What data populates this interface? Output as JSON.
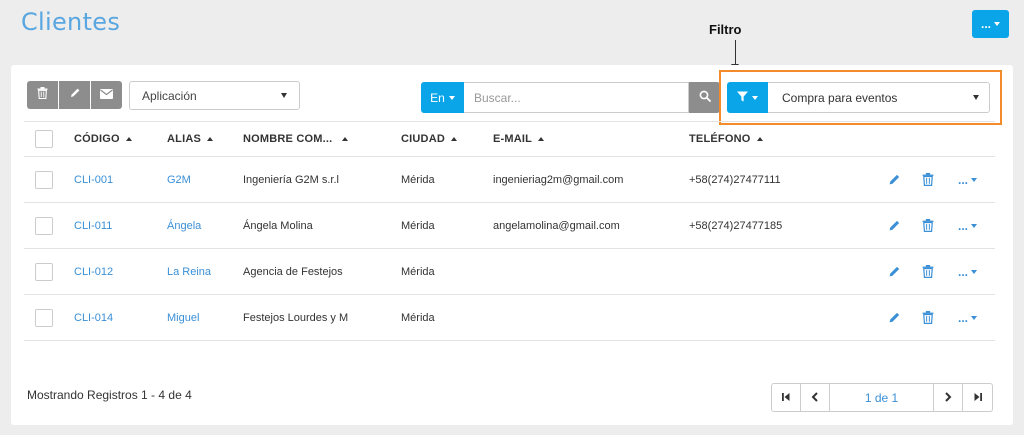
{
  "page": {
    "title": "Clientes"
  },
  "top_actions": {
    "more_label": "..."
  },
  "annotation": {
    "label": "Filtro"
  },
  "toolbar": {
    "buttons": [
      {
        "name": "delete",
        "icon": "trash-icon"
      },
      {
        "name": "edit",
        "icon": "pencil-icon"
      },
      {
        "name": "email",
        "icon": "envelope-icon"
      }
    ],
    "app_select": {
      "value": "Aplicación"
    }
  },
  "search": {
    "scope_label": "En",
    "placeholder": "Buscar...",
    "value": ""
  },
  "filter": {
    "value": "Compra para eventos"
  },
  "table": {
    "headers": {
      "codigo": "CÓDIGO",
      "alias": "ALIAS",
      "nombre": "NOMBRE COM...",
      "ciudad": "CIUDAD",
      "email": "E-MAIL",
      "telefono": "TELÉFONO"
    },
    "rows": [
      {
        "codigo": "CLI-001",
        "alias": "G2M",
        "nombre": "Ingeniería G2M s.r.l",
        "ciudad": "Mérida",
        "email": "ingenieriag2m@gmail.com",
        "telefono": "+58(274)27477111"
      },
      {
        "codigo": "CLI-011",
        "alias": "Ángela",
        "nombre": "Ángela Molina",
        "ciudad": "Mérida",
        "email": "angelamolina@gmail.com",
        "telefono": "+58(274)27477185"
      },
      {
        "codigo": "CLI-012",
        "alias": "La Reina",
        "nombre": "Agencia de Festejos",
        "ciudad": "Mérida",
        "email": "",
        "telefono": ""
      },
      {
        "codigo": "CLI-014",
        "alias": "Miguel",
        "nombre": "Festejos Lourdes y M",
        "ciudad": "Mérida",
        "email": "",
        "telefono": ""
      }
    ],
    "row_more_label": "..."
  },
  "footer": {
    "status": "Mostrando Registros 1 - 4 de 4",
    "pager_info": "1 de 1"
  },
  "colors": {
    "accent": "#0aa5e8",
    "link": "#3a8fd6",
    "highlight": "#f48b2a",
    "gray_button": "#8d8d8d"
  }
}
